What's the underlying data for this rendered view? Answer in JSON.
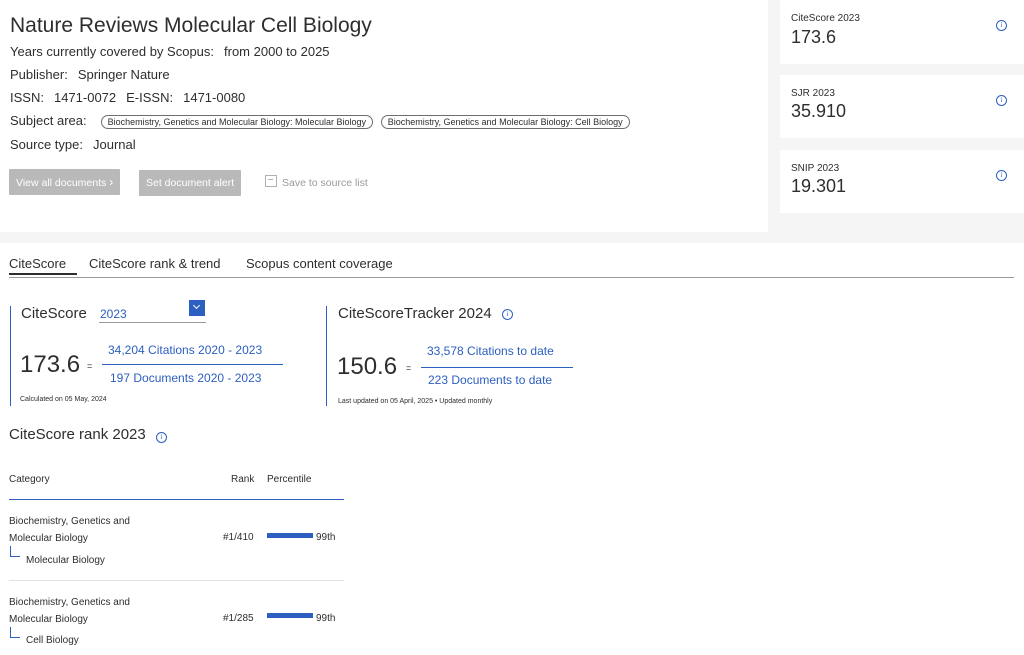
{
  "journal": {
    "title": "Nature Reviews Molecular Cell Biology",
    "years_label": "Years currently covered by Scopus:",
    "years_value": "from 2000 to 2025",
    "publisher_label": "Publisher:",
    "publisher_value": "Springer Nature",
    "issn_label": "ISSN:",
    "issn_value": "1471-0072",
    "eissn_label": "E-ISSN:",
    "eissn_value": "1471-0080",
    "subject_label": "Subject area:",
    "subjects": [
      "Biochemistry, Genetics and Molecular Biology: Molecular Biology",
      "Biochemistry, Genetics and Molecular Biology: Cell Biology"
    ],
    "source_type_label": "Source type:",
    "source_type_value": "Journal"
  },
  "actions": {
    "view_all": "View all documents",
    "set_alert": "Set document alert",
    "save": "Save to source list"
  },
  "metrics": [
    {
      "label": "CiteScore 2023",
      "value": "173.6",
      "icon": "info-icon"
    },
    {
      "label": "SJR 2023",
      "value": "35.910",
      "icon": "info-icon"
    },
    {
      "label": "SNIP 2023",
      "value": "19.301",
      "icon": "info-icon"
    }
  ],
  "tabs": [
    "CiteScore",
    "CiteScore rank & trend",
    "Scopus content coverage"
  ],
  "citescore": {
    "label": "CiteScore",
    "year": "2023",
    "value": "173.6",
    "eq": "=",
    "numerator": "34,204 Citations 2020 - 2023",
    "denominator": "197 Documents 2020 - 2023",
    "note": "Calculated on 05 May, 2024"
  },
  "tracker": {
    "label": "CiteScoreTracker 2024",
    "value": "150.6",
    "eq": "=",
    "numerator": "33,578 Citations to date",
    "denominator": "223 Documents to date",
    "note": "Last updated on 05 April, 2025 • Updated monthly"
  },
  "rank": {
    "title": "CiteScore rank 2023",
    "headers": {
      "category": "Category",
      "rank": "Rank",
      "percentile": "Percentile"
    },
    "rows": [
      {
        "category_line1": "Biochemistry, Genetics and",
        "category_line2": "Molecular Biology",
        "subcategory": "Molecular Biology",
        "rank": "#1/410",
        "percentile": "99th",
        "percentile_value": 99
      },
      {
        "category_line1": "Biochemistry, Genetics and",
        "category_line2": "Molecular Biology",
        "subcategory": "Cell Biology",
        "rank": "#1/285",
        "percentile": "99th",
        "percentile_value": 99
      }
    ]
  },
  "colors": {
    "accent": "#2c5fbf",
    "button_gray": "#b9b9b9"
  }
}
